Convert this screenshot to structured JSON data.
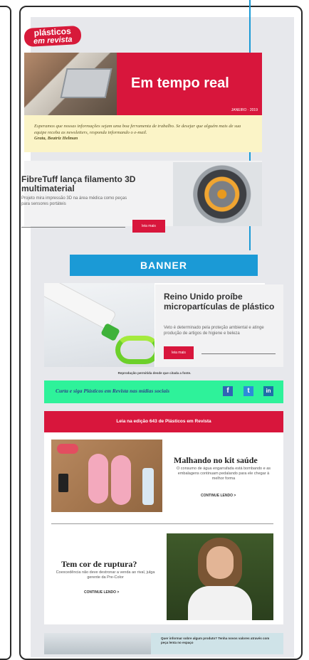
{
  "logo": {
    "line1": "plásticos",
    "line2": "em revista"
  },
  "hero": {
    "title": "Em tempo real",
    "date": "JANEIRO · 2019"
  },
  "intro": {
    "text": "Esperamos que nossas informações sejam uma boa ferramenta de trabalho. Se desejar que alguém mais de sua equipe receba as newsletters, responda informando o e-mail.",
    "signoff": "Grata, Beatriz Helman"
  },
  "article1": {
    "title": "FibreTuff lança filamento 3D multimaterial",
    "description": "Projeto mira impressão 3D na área médica como peças para sensores portáteis",
    "button": "leia mais"
  },
  "banner": {
    "label": "BANNER"
  },
  "article2": {
    "title": "Reino Unido proíbe micropartículas de plástico",
    "description": "Veto é determinado pela proteção ambiental e atinge produção de artigos de higiene e beleza",
    "button": "leia mais"
  },
  "reproduction_note": "Reprodução permitida desde que citada a fonte.",
  "social": {
    "text": "Curta e siga Plásticos em Revista nas mídias sociais",
    "facebook": "f",
    "twitter": "t",
    "linkedin": "in"
  },
  "edition": {
    "heading": "Leia na edição 643 de Plásticos em Revista",
    "articles": [
      {
        "title": "Malhando no kit saúde",
        "description": "O consumo de água engarrafada está bombando e as embalagens continuam pedalando para ele chegar à melhor forma",
        "more": "CONTINUE LENDO >"
      },
      {
        "title": "Tem cor de ruptura?",
        "description": "Coexcedência não deve destronar a venda ao rival, julga gerente da Pre-Color",
        "more": "CONTINUE LENDO >"
      }
    ]
  },
  "bottom": {
    "text": "Quer informar sobre algum produto? Tenha novos valores através com peça lenta no espaço"
  },
  "colors": {
    "accent_red": "#d8163c",
    "banner_blue": "#1b9ad6",
    "social_green": "#2ef29a",
    "intro_yellow": "#fbf4c7"
  }
}
